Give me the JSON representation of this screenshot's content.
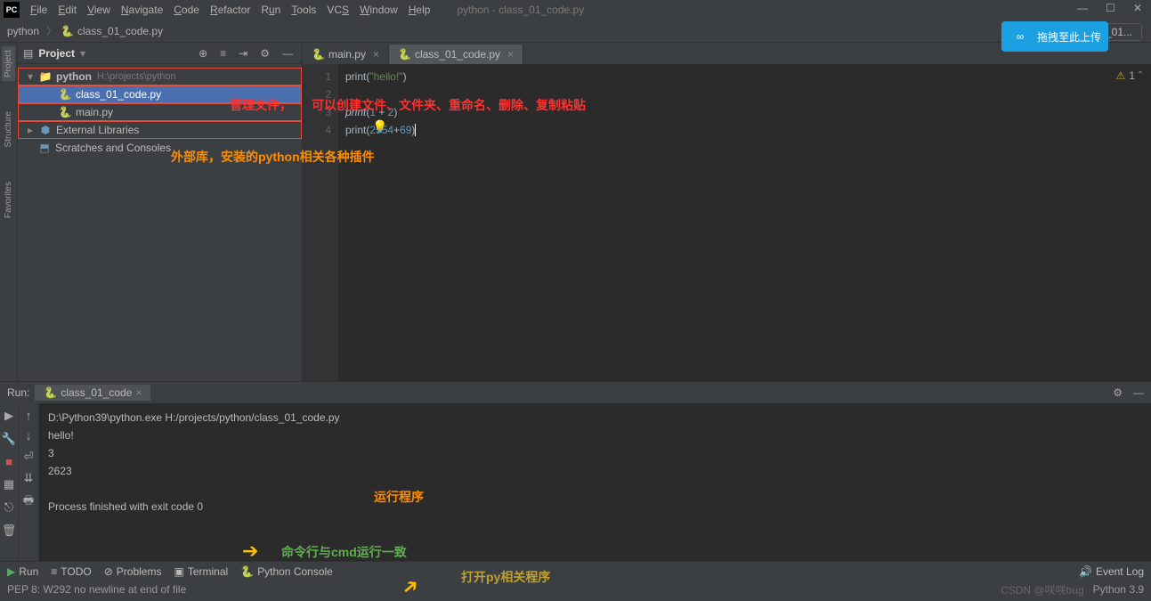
{
  "window": {
    "title": "python - class_01_code.py"
  },
  "menu": {
    "file": "File",
    "edit": "Edit",
    "view": "View",
    "navigate": "Navigate",
    "code": "Code",
    "refactor": "Refactor",
    "run": "Run",
    "tools": "Tools",
    "vcs": "VCS",
    "window": "Window",
    "help": "Help"
  },
  "breadcrumb": {
    "root": "python",
    "file": "class_01_code.py"
  },
  "run_config": {
    "name": "class_01..."
  },
  "upload": {
    "label": "拖拽至此上传"
  },
  "project_panel": {
    "title": "Project",
    "root": {
      "name": "python",
      "path": "H:\\projects\\python"
    },
    "files": [
      "class_01_code.py",
      "main.py"
    ],
    "external": "External Libraries",
    "scratches": "Scratches and Consoles"
  },
  "side_tabs": {
    "project": "Project",
    "structure": "Structure",
    "favorites": "Favorites"
  },
  "editor": {
    "tabs": [
      {
        "label": "main.py"
      },
      {
        "label": "class_01_code.py",
        "active": true
      }
    ],
    "lines": [
      {
        "n": "1",
        "html": "print(<span class='str'>\"hello!\"</span>)"
      },
      {
        "n": "2",
        "html": ""
      },
      {
        "n": "3",
        "html": "<span class='fn'>print</span>(<span class='num'>1</span> + <span class='num'>2</span>)"
      },
      {
        "n": "4",
        "html": "print(<span class='num'>2554</span>+<span class='num'>69</span>)<span class='caret'></span>"
      }
    ],
    "warn_count": "1"
  },
  "run_panel": {
    "title": "Run:",
    "tab": "class_01_code",
    "output": [
      "D:\\Python39\\python.exe H:/projects/python/class_01_code.py",
      "hello!",
      "3",
      "2623",
      "",
      "Process finished with exit code 0"
    ]
  },
  "bottom": {
    "run": "Run",
    "todo": "TODO",
    "problems": "Problems",
    "terminal": "Terminal",
    "pyconsole": "Python Console",
    "eventlog": "Event Log"
  },
  "status": {
    "msg": "PEP 8: W292 no newline at end of file",
    "watermark": "CSDN @咲咲bug",
    "py": "Python 3.9"
  },
  "annotations": {
    "manage": "管理文件，",
    "create": "可以创建文件、文件夹、重命名、删除、复制粘贴",
    "external": "外部库，安装的python相关各种插件",
    "runprog": "运行程序",
    "cmdline": "命令行与cmd运行一致",
    "openpy": "打开py相关程序"
  }
}
